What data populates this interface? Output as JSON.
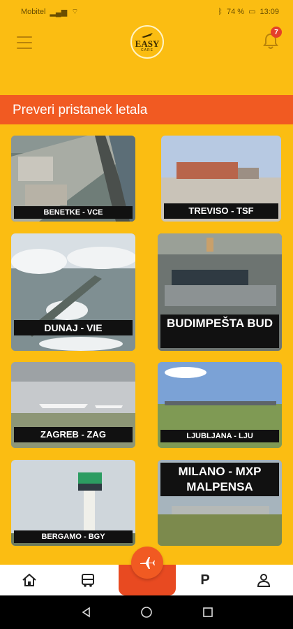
{
  "status": {
    "carrier": "Mobitel",
    "battery": "74 %",
    "time": "13:09"
  },
  "header": {
    "logo_text": "EASY",
    "logo_sub": "CARE",
    "notification_count": "7"
  },
  "section_title": "Preveri pristanek letala",
  "airports": [
    {
      "label": "BENETKE - VCE"
    },
    {
      "label": "TREVISO - TSF"
    },
    {
      "label": "DUNAJ - VIE"
    },
    {
      "label": "BUDIMPEŠTA BUD"
    },
    {
      "label": "ZAGREB - ZAG"
    },
    {
      "label": "LJUBLJANA - LJU"
    },
    {
      "label": "BERGAMO - BGY"
    },
    {
      "label": "MILANO - MXP MALPENSA"
    }
  ],
  "bottom_nav": [
    {
      "icon": "home-icon"
    },
    {
      "icon": "bus-icon"
    },
    {
      "icon": "airplane-icon"
    },
    {
      "icon": "parking-icon",
      "label": "P"
    },
    {
      "icon": "user-icon"
    }
  ]
}
